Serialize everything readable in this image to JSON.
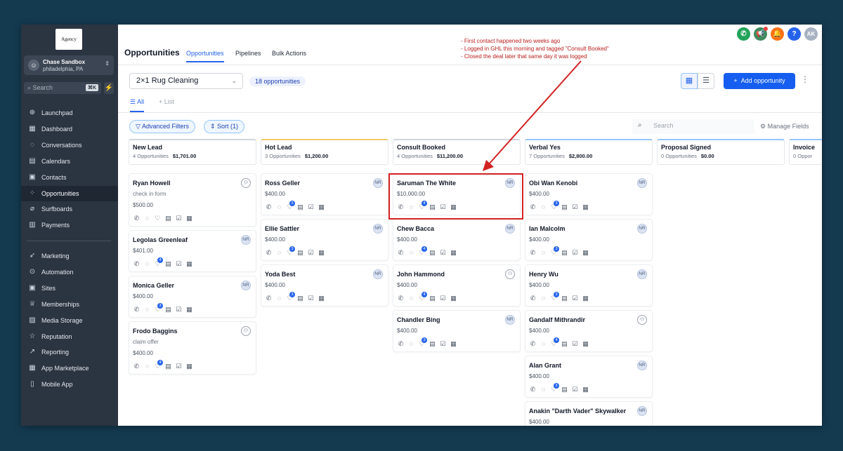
{
  "app": {
    "logo_text": "Agency"
  },
  "account": {
    "name": "Chase Sandbox",
    "location": "philadelphia, PA"
  },
  "sidebar": {
    "search_placeholder": "Search",
    "search_shortcut": "⌘K",
    "items": [
      {
        "label": "Launchpad",
        "icon": "launchpad-icon"
      },
      {
        "label": "Dashboard",
        "icon": "dashboard-icon"
      },
      {
        "label": "Conversations",
        "icon": "chat-icon"
      },
      {
        "label": "Calendars",
        "icon": "calendar-icon"
      },
      {
        "label": "Contacts",
        "icon": "contacts-icon"
      },
      {
        "label": "Opportunities",
        "icon": "opportunities-icon",
        "active": true
      },
      {
        "label": "Surfboards",
        "icon": "surfboard-icon"
      },
      {
        "label": "Payments",
        "icon": "payments-icon"
      }
    ],
    "items2": [
      {
        "label": "Marketing",
        "icon": "send-icon"
      },
      {
        "label": "Automation",
        "icon": "automation-icon"
      },
      {
        "label": "Sites",
        "icon": "sites-icon"
      },
      {
        "label": "Memberships",
        "icon": "membership-icon"
      },
      {
        "label": "Media Storage",
        "icon": "media-icon"
      },
      {
        "label": "Reputation",
        "icon": "star-icon"
      },
      {
        "label": "Reporting",
        "icon": "reporting-icon"
      },
      {
        "label": "App Marketplace",
        "icon": "apps-icon"
      },
      {
        "label": "Mobile App",
        "icon": "mobile-icon"
      }
    ]
  },
  "header": {
    "title": "Opportunities",
    "tabs": [
      "Opportunities",
      "Pipelines",
      "Bulk Actions"
    ],
    "avatar": "AK"
  },
  "annotation": {
    "lines": [
      "- First contact happened two weeks ago",
      "- Logged in GHL this morning and tagged \"Consult Booked\"",
      "- Closed the deal later that same day it was logged"
    ]
  },
  "toolbar": {
    "pipeline": "2×1 Rug Cleaning",
    "count": "18 opportunities",
    "add_label": "Add opportunity",
    "all_tab": "All",
    "list_tab": "+ List",
    "advanced_filters": "Advanced Filters",
    "sort": "Sort (1)",
    "search_placeholder": "Search",
    "manage_fields": "Manage Fields"
  },
  "columns": [
    {
      "name": "New Lead",
      "count": "4 Opportunities",
      "total": "$1,701.00",
      "color": "#cfd6df",
      "cards": [
        {
          "name": "Ryan Howell",
          "sub": "check in form",
          "value": "$500.00",
          "badge": "person",
          "badge_count": ""
        },
        {
          "name": "Legolas Greenleaf",
          "value": "$401.00",
          "badge": "NR",
          "badge_count": "4"
        },
        {
          "name": "Monica Geller",
          "value": "$400.00",
          "badge": "NR",
          "badge_count": "3"
        },
        {
          "name": "Frodo Baggins",
          "sub": "claim offer",
          "value": "$400.00",
          "badge": "person",
          "badge_count": "4"
        }
      ]
    },
    {
      "name": "Hot Lead",
      "count": "3 Opportunities",
      "total": "$1,200.00",
      "color": "#f6c86a",
      "cards": [
        {
          "name": "Ross Geller",
          "value": "$400.00",
          "badge": "NR",
          "badge_count": "3"
        },
        {
          "name": "Ellie Sattler",
          "value": "$400.00",
          "badge": "NR",
          "badge_count": "3"
        },
        {
          "name": "Yoda Best",
          "value": "$400.00",
          "badge": "NR",
          "badge_count": "3"
        }
      ]
    },
    {
      "name": "Consult Booked",
      "count": "4 Opportunities",
      "total": "$11,200.00",
      "color": "#cfd6df",
      "cards": [
        {
          "name": "Saruman The White",
          "value": "$10,000.00",
          "badge": "NR",
          "badge_count": "4"
        },
        {
          "name": "Chew Bacca",
          "value": "$400.00",
          "badge": "NR",
          "badge_count": "4"
        },
        {
          "name": "John Hammond",
          "value": "$400.00",
          "badge": "person",
          "badge_count": "4"
        },
        {
          "name": "Chandler Bing",
          "value": "$400.00",
          "badge": "NR",
          "badge_count": "3"
        }
      ]
    },
    {
      "name": "Verbal Yes",
      "count": "7 Opportunities",
      "total": "$2,800.00",
      "color": "#93c5fd",
      "cards": [
        {
          "name": "Obi Wan Kenobi",
          "value": "$400.00",
          "badge": "NR",
          "badge_count": "3"
        },
        {
          "name": "Ian Malcolm",
          "value": "$400.00",
          "badge": "NR",
          "badge_count": "3"
        },
        {
          "name": "Henry Wu",
          "value": "$400.00",
          "badge": "NR",
          "badge_count": "3"
        },
        {
          "name": "Gandalf Mithrandir",
          "value": "$400.00",
          "badge": "person",
          "badge_count": "4"
        },
        {
          "name": "Alan Grant",
          "value": "$400.00",
          "badge": "NR",
          "badge_count": "3"
        },
        {
          "name": "Anakin \"Darth Vader\" Skywalker",
          "value": "$400.00",
          "badge": "NR",
          "badge_count": ""
        }
      ]
    },
    {
      "name": "Proposal Signed",
      "count": "0 Opportunities",
      "total": "$0.00",
      "color": "#93c5fd",
      "cards": []
    },
    {
      "name": "Invoice",
      "count": "0 Oppor",
      "total": "",
      "color": "#93c5fd",
      "cards": []
    }
  ]
}
